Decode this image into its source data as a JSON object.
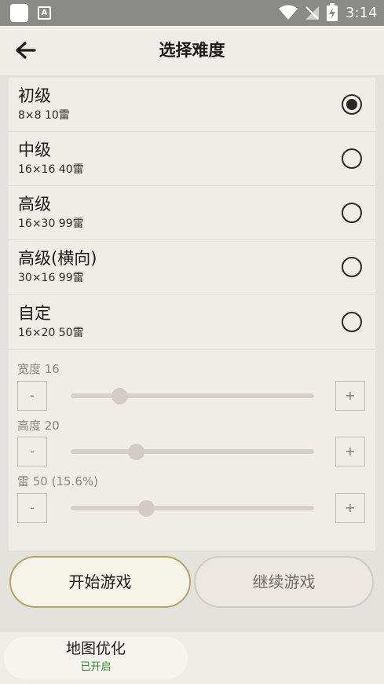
{
  "status_bar": {
    "time": "3:14",
    "badge": "A"
  },
  "header": {
    "title": "选择难度"
  },
  "options": [
    {
      "name": "初级",
      "desc": "8×8  10雷",
      "selected": true
    },
    {
      "name": "中级",
      "desc": "16×16  40雷",
      "selected": false
    },
    {
      "name": "高级",
      "desc": "16×30  99雷",
      "selected": false
    },
    {
      "name": "高级(横向)",
      "desc": "30×16  99雷",
      "selected": false
    },
    {
      "name": "自定",
      "desc": "16×20  50雷",
      "selected": false
    }
  ],
  "custom": {
    "width": {
      "label": "宽度   16",
      "minus": "-",
      "plus": "+",
      "fraction": 0.2
    },
    "height": {
      "label": "高度   20",
      "minus": "-",
      "plus": "+",
      "fraction": 0.27
    },
    "mines": {
      "label": "雷   50 (15.6%)",
      "minus": "-",
      "plus": "+",
      "fraction": 0.31
    }
  },
  "actions": {
    "start": "开始游戏",
    "continue": "继续游戏"
  },
  "map_optimize": {
    "title": "地图优化",
    "status": "已开启"
  },
  "colors": {
    "accent_border": "#b6a461",
    "enabled_status": "#2f8a2a"
  }
}
